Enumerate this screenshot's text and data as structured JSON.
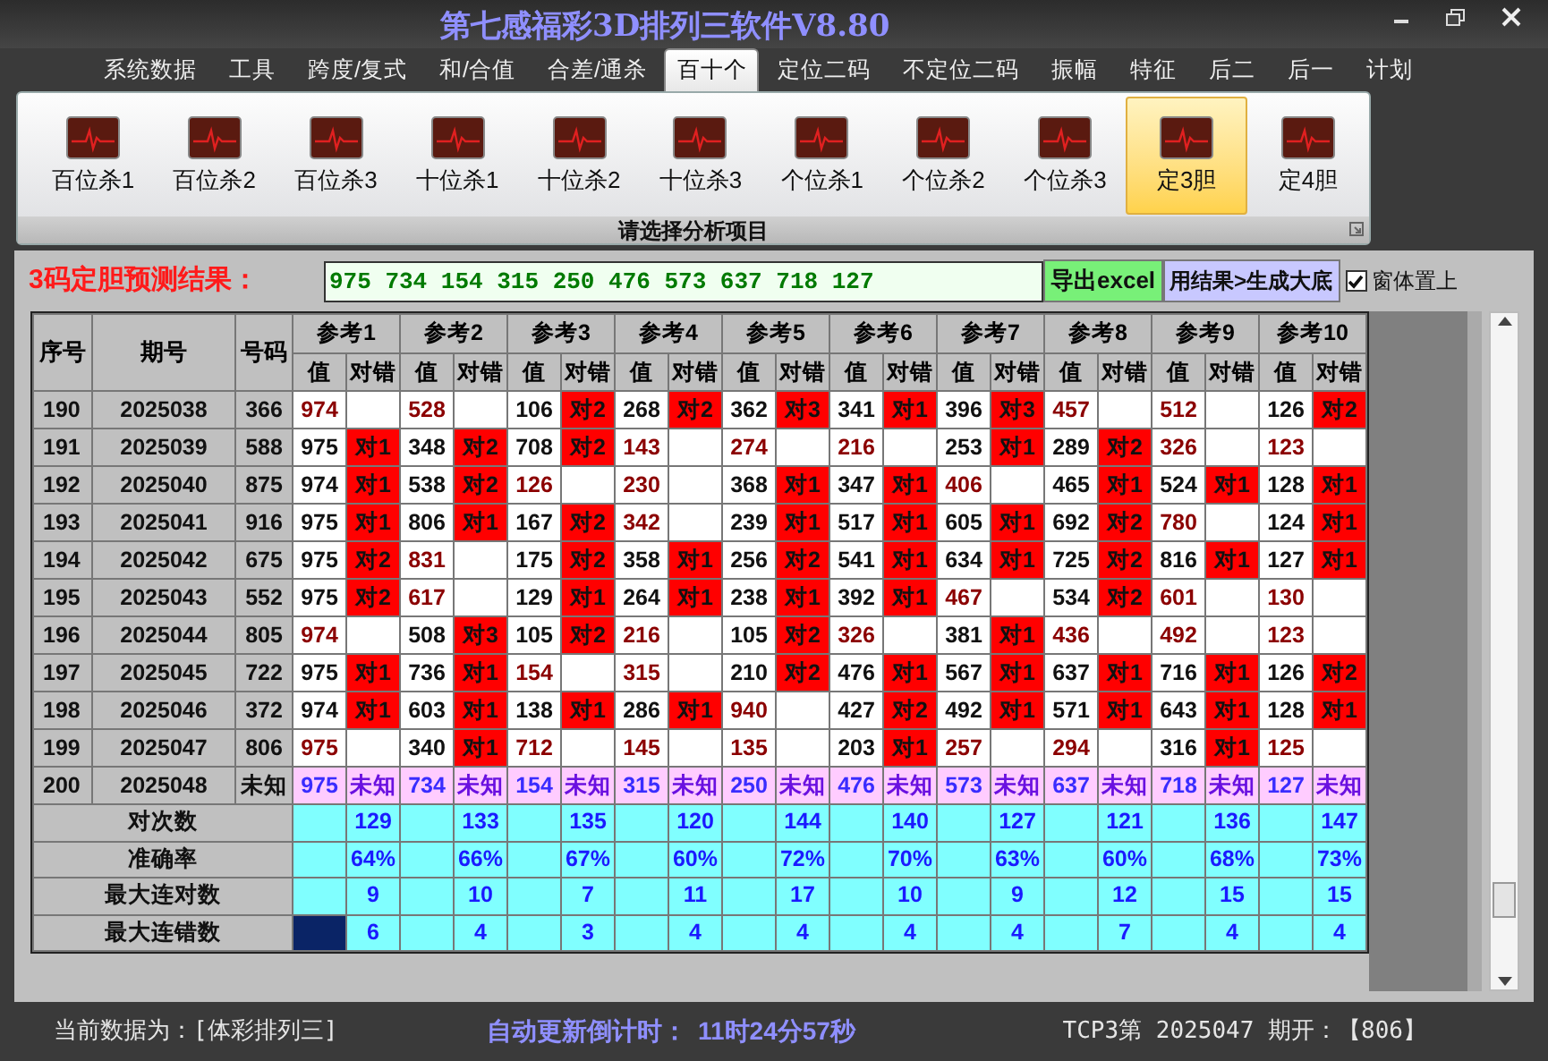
{
  "window": {
    "title": "第七感福彩3D排列三软件V8.80"
  },
  "menu_tabs": [
    {
      "label": "系统数据",
      "selected": false
    },
    {
      "label": "工具",
      "selected": false
    },
    {
      "label": "跨度/复式",
      "selected": false
    },
    {
      "label": "和/合值",
      "selected": false
    },
    {
      "label": "合差/通杀",
      "selected": false
    },
    {
      "label": "百十个",
      "selected": true
    },
    {
      "label": "定位二码",
      "selected": false
    },
    {
      "label": "不定位二码",
      "selected": false
    },
    {
      "label": "振幅",
      "selected": false
    },
    {
      "label": "特征",
      "selected": false
    },
    {
      "label": "后二",
      "selected": false
    },
    {
      "label": "后一",
      "selected": false
    },
    {
      "label": "计划",
      "selected": false
    }
  ],
  "ribbon": {
    "group_label": "请选择分析项目",
    "items": [
      {
        "label": "百位杀1",
        "selected": false
      },
      {
        "label": "百位杀2",
        "selected": false
      },
      {
        "label": "百位杀3",
        "selected": false
      },
      {
        "label": "十位杀1",
        "selected": false
      },
      {
        "label": "十位杀2",
        "selected": false
      },
      {
        "label": "十位杀3",
        "selected": false
      },
      {
        "label": "个位杀1",
        "selected": false
      },
      {
        "label": "个位杀2",
        "selected": false
      },
      {
        "label": "个位杀3",
        "selected": false
      },
      {
        "label": "定3胆",
        "selected": true
      },
      {
        "label": "定4胆",
        "selected": false
      }
    ]
  },
  "result_bar": {
    "label": "3码定胆预测结果：",
    "value": "975 734 154 315 250 476 573 637 718 127",
    "export_button": "导出excel",
    "generate_button": "用结果>生成大底",
    "topmost_checkbox": {
      "label": "窗体置上",
      "checked": true
    }
  },
  "table": {
    "columns": [
      "序号",
      "期号",
      "号码"
    ],
    "group_columns": [
      {
        "label": "参考1",
        "sub_columns": [
          "值",
          "对错"
        ]
      },
      {
        "label": "参考2",
        "sub_columns": [
          "值",
          "对错"
        ]
      },
      {
        "label": "参考3",
        "sub_columns": [
          "值",
          "对错"
        ]
      },
      {
        "label": "参考4",
        "sub_columns": [
          "值",
          "对错"
        ]
      },
      {
        "label": "参考5",
        "sub_columns": [
          "值",
          "对错"
        ]
      },
      {
        "label": "参考6",
        "sub_columns": [
          "值",
          "对错"
        ]
      },
      {
        "label": "参考7",
        "sub_columns": [
          "值",
          "对错"
        ]
      },
      {
        "label": "参考8",
        "sub_columns": [
          "值",
          "对错"
        ]
      },
      {
        "label": "参考9",
        "sub_columns": [
          "值",
          "对错"
        ]
      },
      {
        "label": "参考10",
        "sub_columns": [
          "值",
          "对错"
        ]
      }
    ],
    "rows": [
      {
        "kind": "history",
        "seq": "190",
        "issue": "2025038",
        "number": "366",
        "cells": [
          {
            "value": "974"
          },
          {
            "value": "528"
          },
          {
            "value": "106",
            "result": "对2"
          },
          {
            "value": "268",
            "result": "对2"
          },
          {
            "value": "362",
            "result": "对3"
          },
          {
            "value": "341",
            "result": "对1"
          },
          {
            "value": "396",
            "result": "对3"
          },
          {
            "value": "457"
          },
          {
            "value": "512"
          },
          {
            "value": "126",
            "result": "对2"
          }
        ]
      },
      {
        "kind": "history",
        "seq": "191",
        "issue": "2025039",
        "number": "588",
        "cells": [
          {
            "value": "975",
            "result": "对1"
          },
          {
            "value": "348",
            "result": "对2"
          },
          {
            "value": "708",
            "result": "对2"
          },
          {
            "value": "143"
          },
          {
            "value": "274"
          },
          {
            "value": "216"
          },
          {
            "value": "253",
            "result": "对1"
          },
          {
            "value": "289",
            "result": "对2"
          },
          {
            "value": "326"
          },
          {
            "value": "123"
          }
        ]
      },
      {
        "kind": "history",
        "seq": "192",
        "issue": "2025040",
        "number": "875",
        "cells": [
          {
            "value": "974",
            "result": "对1"
          },
          {
            "value": "538",
            "result": "对2"
          },
          {
            "value": "126"
          },
          {
            "value": "230"
          },
          {
            "value": "368",
            "result": "对1"
          },
          {
            "value": "347",
            "result": "对1"
          },
          {
            "value": "406"
          },
          {
            "value": "465",
            "result": "对1"
          },
          {
            "value": "524",
            "result": "对1"
          },
          {
            "value": "128",
            "result": "对1"
          }
        ]
      },
      {
        "kind": "history",
        "seq": "193",
        "issue": "2025041",
        "number": "916",
        "cells": [
          {
            "value": "975",
            "result": "对1"
          },
          {
            "value": "806",
            "result": "对1"
          },
          {
            "value": "167",
            "result": "对2"
          },
          {
            "value": "342"
          },
          {
            "value": "239",
            "result": "对1"
          },
          {
            "value": "517",
            "result": "对1"
          },
          {
            "value": "605",
            "result": "对1"
          },
          {
            "value": "692",
            "result": "对2"
          },
          {
            "value": "780"
          },
          {
            "value": "124",
            "result": "对1"
          }
        ]
      },
      {
        "kind": "history",
        "seq": "194",
        "issue": "2025042",
        "number": "675",
        "cells": [
          {
            "value": "975",
            "result": "对2"
          },
          {
            "value": "831"
          },
          {
            "value": "175",
            "result": "对2"
          },
          {
            "value": "358",
            "result": "对1"
          },
          {
            "value": "256",
            "result": "对2"
          },
          {
            "value": "541",
            "result": "对1"
          },
          {
            "value": "634",
            "result": "对1"
          },
          {
            "value": "725",
            "result": "对2"
          },
          {
            "value": "816",
            "result": "对1"
          },
          {
            "value": "127",
            "result": "对1"
          }
        ]
      },
      {
        "kind": "history",
        "seq": "195",
        "issue": "2025043",
        "number": "552",
        "cells": [
          {
            "value": "975",
            "result": "对2"
          },
          {
            "value": "617"
          },
          {
            "value": "129",
            "result": "对1"
          },
          {
            "value": "264",
            "result": "对1"
          },
          {
            "value": "238",
            "result": "对1"
          },
          {
            "value": "392",
            "result": "对1"
          },
          {
            "value": "467"
          },
          {
            "value": "534",
            "result": "对2"
          },
          {
            "value": "601"
          },
          {
            "value": "130"
          }
        ]
      },
      {
        "kind": "history",
        "seq": "196",
        "issue": "2025044",
        "number": "805",
        "cells": [
          {
            "value": "974"
          },
          {
            "value": "508",
            "result": "对3"
          },
          {
            "value": "105",
            "result": "对2"
          },
          {
            "value": "216"
          },
          {
            "value": "105",
            "result": "对2"
          },
          {
            "value": "326"
          },
          {
            "value": "381",
            "result": "对1"
          },
          {
            "value": "436"
          },
          {
            "value": "492"
          },
          {
            "value": "123"
          }
        ]
      },
      {
        "kind": "history",
        "seq": "197",
        "issue": "2025045",
        "number": "722",
        "cells": [
          {
            "value": "975",
            "result": "对1"
          },
          {
            "value": "736",
            "result": "对1"
          },
          {
            "value": "154"
          },
          {
            "value": "315"
          },
          {
            "value": "210",
            "result": "对2"
          },
          {
            "value": "476",
            "result": "对1"
          },
          {
            "value": "567",
            "result": "对1"
          },
          {
            "value": "637",
            "result": "对1"
          },
          {
            "value": "716",
            "result": "对1"
          },
          {
            "value": "126",
            "result": "对2"
          }
        ]
      },
      {
        "kind": "history",
        "seq": "198",
        "issue": "2025046",
        "number": "372",
        "cells": [
          {
            "value": "974",
            "result": "对1"
          },
          {
            "value": "603",
            "result": "对1"
          },
          {
            "value": "138",
            "result": "对1"
          },
          {
            "value": "286",
            "result": "对1"
          },
          {
            "value": "940"
          },
          {
            "value": "427",
            "result": "对2"
          },
          {
            "value": "492",
            "result": "对1"
          },
          {
            "value": "571",
            "result": "对1"
          },
          {
            "value": "643",
            "result": "对1"
          },
          {
            "value": "128",
            "result": "对1"
          }
        ]
      },
      {
        "kind": "history",
        "seq": "199",
        "issue": "2025047",
        "number": "806",
        "cells": [
          {
            "value": "975"
          },
          {
            "value": "340",
            "result": "对1"
          },
          {
            "value": "712"
          },
          {
            "value": "145"
          },
          {
            "value": "135"
          },
          {
            "value": "203",
            "result": "对1"
          },
          {
            "value": "257"
          },
          {
            "value": "294"
          },
          {
            "value": "316",
            "result": "对1"
          },
          {
            "value": "125"
          }
        ]
      },
      {
        "kind": "forecast",
        "seq": "200",
        "issue": "2025048",
        "number": "未知",
        "cells": [
          {
            "value": "975",
            "result": "未知"
          },
          {
            "value": "734",
            "result": "未知"
          },
          {
            "value": "154",
            "result": "未知"
          },
          {
            "value": "315",
            "result": "未知"
          },
          {
            "value": "250",
            "result": "未知"
          },
          {
            "value": "476",
            "result": "未知"
          },
          {
            "value": "573",
            "result": "未知"
          },
          {
            "value": "637",
            "result": "未知"
          },
          {
            "value": "718",
            "result": "未知"
          },
          {
            "value": "127",
            "result": "未知"
          }
        ]
      }
    ],
    "summary": [
      {
        "label": "对次数",
        "values": [
          "129",
          "133",
          "135",
          "120",
          "144",
          "140",
          "127",
          "121",
          "136",
          "147"
        ],
        "selected": false
      },
      {
        "label": "准确率",
        "values": [
          "64%",
          "66%",
          "67%",
          "60%",
          "72%",
          "70%",
          "63%",
          "60%",
          "68%",
          "73%"
        ],
        "selected": false
      },
      {
        "label": "最大连对数",
        "values": [
          "9",
          "10",
          "7",
          "11",
          "17",
          "10",
          "9",
          "12",
          "15",
          "15"
        ],
        "selected": false
      },
      {
        "label": "最大连错数",
        "values": [
          "6",
          "4",
          "3",
          "4",
          "4",
          "4",
          "4",
          "7",
          "4",
          "4"
        ],
        "selected": true
      }
    ]
  },
  "status_bar": {
    "data_source": "当前数据为：[体彩排列三]",
    "countdown_label": "自动更新倒计时：",
    "countdown": "11时24分57秒",
    "latest_draw": "TCP3第 2025047 期开：【806】"
  }
}
